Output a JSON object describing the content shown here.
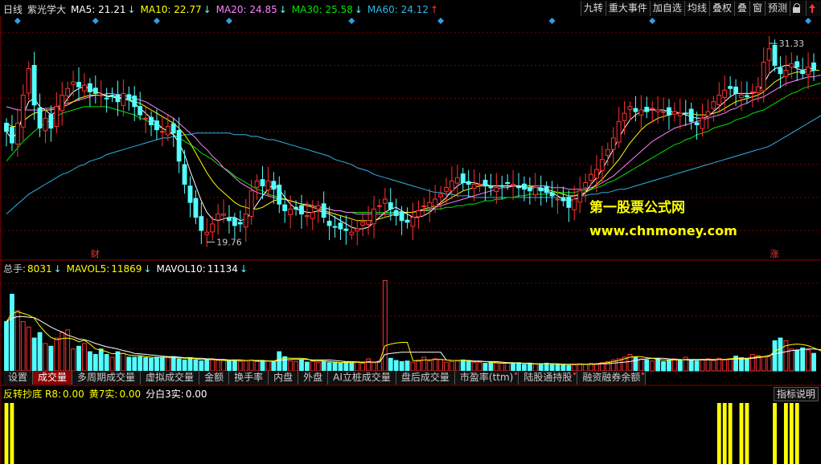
{
  "colors": {
    "up": "#ff3232",
    "down": "#54ffff",
    "ma5": "#ffffff",
    "ma10": "#ffff00",
    "ma20": "#ff80ff",
    "ma30": "#00e600",
    "ma60": "#2fb5e6",
    "grid": "#7a0000",
    "diamond": "#2fa0e0",
    "signal": "#ffff00"
  },
  "header": {
    "period": "日线",
    "name": "紫光学大",
    "ma5": {
      "label": "MA5:",
      "value": "21.21",
      "arrow": "↓"
    },
    "ma10": {
      "label": "MA10:",
      "value": "22.77",
      "arrow": "↓"
    },
    "ma20": {
      "label": "MA20:",
      "value": "24.85",
      "arrow": "↓"
    },
    "ma30": {
      "label": "MA30:",
      "value": "25.58",
      "arrow": "↓"
    },
    "ma60": {
      "label": "MA60:",
      "value": "24.12",
      "arrow": "↑"
    }
  },
  "toolbar": [
    "九转",
    "重大事件",
    "加自选",
    "均线",
    "叠权",
    "叠",
    "窗",
    "预测",
    "lock-icon",
    "up-arrow-icon"
  ],
  "price": {
    "high_label": "31.33",
    "low_label": "19.76",
    "ymin": 18.5,
    "ymax": 32.5,
    "markers": [
      {
        "text": "财",
        "i": 16
      },
      {
        "text": "涨",
        "i": 138
      }
    ],
    "diamonds": [
      2,
      16,
      27,
      40,
      62,
      78,
      98,
      116,
      144
    ]
  },
  "watermark": {
    "line1": "第一股票公式网",
    "line2": "www.chnmoney.com"
  },
  "volume": {
    "label": "总手:",
    "value": "8031",
    "arrow": "↓",
    "mavol5_label": "MAVOL5:",
    "mavol5": "11869",
    "mavol5_arrow": "↓",
    "mavol10_label": "MAVOL10:",
    "mavol10": "11134",
    "mavol10_arrow": "↓"
  },
  "tabs": [
    "设置",
    "成交量",
    "多周期成交量",
    "虚拟成交量",
    "金额",
    "换手率",
    "内盘",
    "外盘",
    "AI立桩成交量",
    "盘后成交量",
    "市盈率(ttm)",
    "陆股通持股",
    "融资融券余额"
  ],
  "active_tab": 1,
  "indicator": {
    "name": "反转抄底",
    "r8_label": "R8:",
    "r8": "0.00",
    "huang_label": "黄7实:",
    "huang": "0.00",
    "fen_label": "分白3实:",
    "fen": "0.00",
    "button": "指标说明"
  },
  "chart_data": {
    "type": "candlestick",
    "close": [
      26,
      25.3,
      26.5,
      28.2,
      29.8,
      27.6,
      26.2,
      26.8,
      26.2,
      27.5,
      28.2,
      28.6,
      29,
      28.7,
      28.8,
      28.4,
      28.3,
      28.2,
      28,
      28.1,
      27.8,
      28.3,
      27.9,
      27.5,
      27,
      26.8,
      26.4,
      26.1,
      26,
      26.3,
      25.9,
      24.2,
      22.8,
      21.7,
      20.8,
      20,
      19.9,
      20.4,
      21,
      21,
      20.6,
      20.3,
      20.4,
      21,
      22.4,
      23,
      22.7,
      23,
      22.5,
      21.6,
      21.2,
      21.3,
      21.3,
      21,
      20.9,
      21.1,
      21.5,
      20.8,
      20.3,
      20.2,
      20.1,
      20,
      19.9,
      20.1,
      20.5,
      20.6,
      21.3,
      21.5,
      21.9,
      21.3,
      20.9,
      20.6,
      20.5,
      20.8,
      21.2,
      21.5,
      21.7,
      21.9,
      22.2,
      22.6,
      23,
      23.2,
      22.9,
      22.8,
      22.8,
      22.8,
      22.7,
      22.6,
      22.6,
      22.7,
      22.9,
      22.8,
      22.6,
      22.5,
      22.4,
      22.6,
      22.4,
      22.3,
      22.1,
      21.9,
      21.8,
      21.4,
      21.9,
      22.4,
      22.9,
      23.4,
      23.7,
      24.3,
      24.9,
      25.6,
      26.6,
      27.1,
      27.5,
      27.2,
      27.3,
      27.2,
      27.4,
      27.3,
      27.2,
      27,
      27.2,
      27.1,
      27.1,
      26.6,
      26.4,
      26.8,
      27.2,
      27.8,
      28.2,
      28.5,
      28.6,
      28.3,
      28.2,
      28.1,
      28.4,
      28.7,
      30.2,
      31,
      30,
      29.5,
      29.7,
      30.1,
      29.9,
      29.5,
      29.9,
      29.7
    ],
    "ma5": [
      26,
      25.5,
      26,
      27,
      27.8,
      28,
      27.5,
      27.3,
      27,
      27.2,
      27.5,
      28,
      28.4,
      28.6,
      28.7,
      28.6,
      28.4,
      28.3,
      28.1,
      28.1,
      28,
      28,
      27.9,
      27.7,
      27.4,
      27.1,
      26.8,
      26.5,
      26.2,
      26,
      25.8,
      25.3,
      24.6,
      23.6,
      22.7,
      21.8,
      21.1,
      20.7,
      20.6,
      20.7,
      20.8,
      20.8,
      20.6,
      20.7,
      21.1,
      21.6,
      22.1,
      22.5,
      22.8,
      22.5,
      22,
      21.6,
      21.3,
      21.2,
      21.1,
      21.1,
      21.2,
      21.1,
      21,
      20.8,
      20.6,
      20.4,
      20.2,
      20.1,
      20.1,
      20.2,
      20.5,
      20.8,
      21.1,
      21.3,
      21.4,
      21.2,
      21,
      20.8,
      20.8,
      20.9,
      21.1,
      21.4,
      21.7,
      22,
      22.4,
      22.7,
      22.9,
      22.9,
      22.9,
      22.8,
      22.8,
      22.7,
      22.7,
      22.7,
      22.7,
      22.7,
      22.7,
      22.6,
      22.6,
      22.5,
      22.5,
      22.4,
      22.3,
      22.1,
      21.9,
      21.8,
      21.9,
      22,
      22.3,
      22.8,
      23.2,
      23.7,
      24.3,
      24.9,
      25.6,
      26.2,
      26.7,
      27,
      27.2,
      27.3,
      27.3,
      27.3,
      27.3,
      27.2,
      27.2,
      27.1,
      27,
      26.9,
      26.8,
      26.8,
      26.9,
      27.2,
      27.5,
      27.8,
      28.1,
      28.3,
      28.3,
      28.3,
      28.3,
      28.4,
      28.9,
      29.5,
      29.8,
      29.9,
      30,
      30,
      29.8,
      29.7,
      29.8,
      29.8
    ],
    "ma10": [
      26.5,
      26.3,
      26.3,
      26.6,
      26.9,
      27.1,
      27.2,
      27.3,
      27.3,
      27.4,
      27.5,
      27.6,
      27.8,
      28,
      28.1,
      28.2,
      28.2,
      28.2,
      28.2,
      28.1,
      28.1,
      28,
      27.9,
      27.8,
      27.7,
      27.5,
      27.3,
      27.1,
      26.9,
      26.7,
      26.5,
      26.2,
      25.8,
      25.3,
      24.7,
      24.1,
      23.5,
      23,
      22.6,
      22.3,
      22,
      21.7,
      21.5,
      21.4,
      21.3,
      21.3,
      21.4,
      21.6,
      21.8,
      21.9,
      21.9,
      21.8,
      21.7,
      21.6,
      21.5,
      21.4,
      21.3,
      21.2,
      21.1,
      21,
      20.9,
      20.8,
      20.7,
      20.6,
      20.6,
      20.6,
      20.6,
      20.7,
      20.8,
      20.9,
      21,
      21,
      21.1,
      21.1,
      21.2,
      21.3,
      21.4,
      21.5,
      21.6,
      21.8,
      22,
      22.2,
      22.4,
      22.5,
      22.6,
      22.7,
      22.7,
      22.7,
      22.7,
      22.7,
      22.7,
      22.7,
      22.7,
      22.7,
      22.7,
      22.6,
      22.6,
      22.5,
      22.4,
      22.3,
      22.2,
      22.1,
      22.1,
      22.2,
      22.3,
      22.5,
      22.8,
      23.1,
      23.5,
      23.9,
      24.3,
      24.8,
      25.3,
      25.7,
      26.1,
      26.4,
      26.6,
      26.8,
      26.9,
      27,
      27.1,
      27.1,
      27.1,
      27.1,
      27,
      27,
      27,
      27.1,
      27.2,
      27.4,
      27.6,
      27.8,
      27.9,
      28,
      28.1,
      28.2,
      28.4,
      28.7,
      29,
      29.2,
      29.4,
      29.5,
      29.6,
      29.6,
      29.6,
      29.7,
      29.7
    ],
    "ma20": [
      27.5,
      27.4,
      27.3,
      27.3,
      27.3,
      27.3,
      27.3,
      27.4,
      27.4,
      27.5,
      27.6,
      27.7,
      27.8,
      27.9,
      28,
      28.1,
      28.2,
      28.2,
      28.3,
      28.3,
      28.2,
      28.2,
      28.1,
      28,
      27.9,
      27.8,
      27.6,
      27.4,
      27.2,
      27,
      26.8,
      26.5,
      26.2,
      25.9,
      25.6,
      25.2,
      24.9,
      24.5,
      24.2,
      23.8,
      23.5,
      23.2,
      22.9,
      22.7,
      22.5,
      22.3,
      22.2,
      22.1,
      22,
      21.9,
      21.9,
      21.8,
      21.7,
      21.6,
      21.6,
      21.5,
      21.4,
      21.4,
      21.3,
      21.2,
      21.2,
      21.1,
      21.1,
      21,
      21,
      21,
      21,
      21,
      21,
      21,
      21.1,
      21.1,
      21.1,
      21.1,
      21.2,
      21.2,
      21.3,
      21.4,
      21.5,
      21.6,
      21.7,
      21.8,
      21.9,
      22,
      22.1,
      22.2,
      22.3,
      22.4,
      22.5,
      22.6,
      22.6,
      22.7,
      22.7,
      22.7,
      22.7,
      22.7,
      22.7,
      22.7,
      22.6,
      22.6,
      22.6,
      22.5,
      22.5,
      22.5,
      22.5,
      22.6,
      22.7,
      22.9,
      23.1,
      23.3,
      23.6,
      23.9,
      24.2,
      24.5,
      24.8,
      25.1,
      25.4,
      25.6,
      25.8,
      26,
      26.2,
      26.3,
      26.4,
      26.5,
      26.6,
      26.7,
      26.8,
      26.9,
      27,
      27.1,
      27.3,
      27.4,
      27.6,
      27.7,
      27.9,
      28,
      28.1,
      28.3,
      28.5,
      28.7,
      28.9,
      29,
      29.1,
      29.2,
      29.3,
      29.3,
      29.4,
      29.4
    ],
    "ma30": [
      24.2,
      24.6,
      25,
      25.4,
      25.7,
      26,
      26.3,
      26.5,
      26.7,
      26.9,
      27.1,
      27.2,
      27.3,
      27.4,
      27.5,
      27.5,
      27.5,
      27.5,
      27.5,
      27.4,
      27.3,
      27.2,
      27.1,
      27,
      26.8,
      26.7,
      26.5,
      26.3,
      26.2,
      26,
      25.8,
      25.6,
      25.4,
      25.2,
      25,
      24.7,
      24.5,
      24.3,
      24,
      23.8,
      23.6,
      23.3,
      23.1,
      22.9,
      22.7,
      22.5,
      22.4,
      22.2,
      22.1,
      22,
      21.9,
      21.8,
      21.7,
      21.6,
      21.5,
      21.5,
      21.4,
      21.3,
      21.3,
      21.2,
      21.2,
      21.1,
      21.1,
      21.1,
      21.1,
      21.1,
      21.1,
      21.1,
      21.1,
      21.1,
      21.1,
      21.1,
      21.1,
      21.1,
      21.2,
      21.2,
      21.2,
      21.3,
      21.3,
      21.4,
      21.4,
      21.5,
      21.5,
      21.6,
      21.6,
      21.7,
      21.8,
      21.8,
      21.9,
      21.9,
      22,
      22,
      22.1,
      22.1,
      22.2,
      22.2,
      22.2,
      22.2,
      22.3,
      22.3,
      22.3,
      22.3,
      22.3,
      22.4,
      22.4,
      22.5,
      22.6,
      22.7,
      22.9,
      23,
      23.2,
      23.4,
      23.6,
      23.8,
      24,
      24.2,
      24.4,
      24.6,
      24.8,
      25,
      25.2,
      25.3,
      25.5,
      25.6,
      25.8,
      25.9,
      26,
      26.2,
      26.3,
      26.4,
      26.5,
      26.7,
      26.8,
      26.9,
      27.1,
      27.2,
      27.3,
      27.5,
      27.7,
      27.9,
      28.1,
      28.3,
      28.4,
      28.6,
      28.7,
      28.8,
      28.9,
      29
    ],
    "ma60": [
      21,
      21.3,
      21.6,
      21.9,
      22.2,
      22.4,
      22.6,
      22.8,
      23,
      23.2,
      23.4,
      23.5,
      23.7,
      23.9,
      24,
      24.2,
      24.3,
      24.4,
      24.6,
      24.7,
      24.8,
      24.9,
      25,
      25.1,
      25.2,
      25.3,
      25.4,
      25.5,
      25.6,
      25.6,
      25.7,
      25.7,
      25.8,
      25.8,
      25.9,
      25.9,
      25.9,
      25.9,
      25.9,
      25.9,
      25.9,
      25.8,
      25.8,
      25.8,
      25.7,
      25.7,
      25.6,
      25.5,
      25.5,
      25.4,
      25.3,
      25.2,
      25.1,
      25,
      24.9,
      24.8,
      24.7,
      24.6,
      24.5,
      24.3,
      24.2,
      24.1,
      24,
      23.8,
      23.7,
      23.6,
      23.4,
      23.3,
      23.2,
      23.1,
      23,
      22.9,
      22.8,
      22.7,
      22.6,
      22.5,
      22.4,
      22.3,
      22.3,
      22.2,
      22.2,
      22.1,
      22.1,
      22.1,
      22,
      22,
      22,
      22,
      22,
      22,
      22,
      22,
      22,
      22,
      22,
      22,
      22,
      22,
      22,
      22,
      22,
      22,
      22.1,
      22.1,
      22.1,
      22.2,
      22.2,
      22.3,
      22.3,
      22.4,
      22.5,
      22.5,
      22.6,
      22.7,
      22.8,
      22.9,
      23,
      23.1,
      23.2,
      23.3,
      23.4,
      23.5,
      23.6,
      23.7,
      23.8,
      23.9,
      24,
      24.1,
      24.2,
      24.3,
      24.4,
      24.5,
      24.6,
      24.7,
      24.8,
      24.9,
      25,
      25.1,
      25.3,
      25.5,
      25.7,
      25.9,
      26.1,
      26.3,
      26.5,
      26.7,
      26.9,
      27.1
    ],
    "volume": [
      9000,
      14000,
      11000,
      9000,
      8000,
      6000,
      7000,
      5000,
      4500,
      6000,
      7000,
      7500,
      4000,
      4500,
      5000,
      3500,
      3000,
      4000,
      3000,
      2500,
      3500,
      3200,
      2500,
      2500,
      2600,
      2400,
      2300,
      2500,
      2500,
      2400,
      2600,
      2200,
      2000,
      2400,
      2000,
      1800,
      2200,
      2000,
      1900,
      2000,
      1800,
      2000,
      1700,
      1800,
      2000,
      1700,
      1900,
      1800,
      1700,
      3500,
      2600,
      1800,
      1700,
      2000,
      1600,
      1800,
      1500,
      1700,
      1500,
      1600,
      1400,
      1600,
      1400,
      1700,
      1400,
      2200,
      1500,
      1800,
      16500,
      2300,
      1900,
      1700,
      1800,
      1600,
      2000,
      2500,
      1800,
      2200,
      2100,
      1600,
      1700,
      1800,
      2000,
      1900,
      1500,
      1600,
      1400,
      1500,
      1400,
      1400,
      1400,
      1300,
      1500,
      1200,
      1400,
      1200,
      1300,
      1400,
      1200,
      1100,
      1200,
      1000,
      1100,
      1300,
      1200,
      1400,
      1300,
      1500,
      1700,
      2000,
      2200,
      2500,
      3000,
      2500,
      2200,
      2000,
      1800,
      2200,
      1700,
      2000,
      2200,
      1900,
      2500,
      2000,
      1800,
      2100,
      2200,
      1900,
      2300,
      2000,
      2200,
      2700,
      2400,
      2100,
      3000,
      2800,
      2500,
      2600,
      5500,
      6000,
      5500,
      4000,
      3800,
      4200,
      3800,
      3200,
      2800,
      2500
    ],
    "mavol5": [
      9000,
      10500,
      10800,
      10500,
      10200,
      9600,
      8200,
      7000,
      6100,
      5700,
      5900,
      6000,
      5800,
      5300,
      5600,
      4900,
      4000,
      3800,
      3500,
      3100,
      3200,
      3200,
      2900,
      2800,
      2800,
      2600,
      2500,
      2400,
      2500,
      2500,
      2400,
      2400,
      2300,
      2300,
      2200,
      2100,
      2100,
      2100,
      2000,
      1900,
      1900,
      1900,
      1900,
      1900,
      1900,
      1800,
      1800,
      1800,
      1800,
      2100,
      2400,
      2300,
      2300,
      2300,
      2200,
      1800,
      1800,
      1800,
      1700,
      1600,
      1500,
      1600,
      1500,
      1600,
      1500,
      1700,
      1600,
      1700,
      4600,
      4900,
      5100,
      5200,
      5200,
      1900,
      1800,
      2000,
      2000,
      2100,
      2100,
      2000,
      1900,
      1900,
      1900,
      1800,
      1700,
      1700,
      1700,
      1600,
      1500,
      1400,
      1400,
      1400,
      1400,
      1400,
      1300,
      1300,
      1300,
      1300,
      1300,
      1200,
      1200,
      1200,
      1200,
      1200,
      1200,
      1200,
      1300,
      1400,
      1500,
      1700,
      1900,
      2200,
      2500,
      2600,
      2600,
      2400,
      2300,
      2100,
      2000,
      2000,
      2000,
      2000,
      2100,
      2100,
      2100,
      2100,
      2100,
      2100,
      2100,
      2100,
      2200,
      2300,
      2300,
      2300,
      2400,
      2600,
      2600,
      2700,
      3600,
      4100,
      4600,
      4800,
      4900,
      4800,
      4600,
      4200,
      3800,
      3300
    ],
    "mavol10": [
      9000,
      9600,
      9900,
      9900,
      9800,
      9700,
      9200,
      8600,
      8000,
      7500,
      7100,
      6500,
      6200,
      5800,
      5700,
      5400,
      5000,
      4700,
      4400,
      4200,
      4000,
      3700,
      3500,
      3200,
      3100,
      3000,
      2900,
      2800,
      2700,
      2600,
      2600,
      2500,
      2400,
      2400,
      2300,
      2300,
      2200,
      2200,
      2100,
      2100,
      2000,
      2000,
      2000,
      1900,
      1900,
      1900,
      1900,
      1800,
      1800,
      1900,
      2000,
      2100,
      2100,
      2100,
      2100,
      2000,
      2000,
      2000,
      2000,
      1900,
      1800,
      1700,
      1700,
      1600,
      1600,
      1600,
      1600,
      1600,
      3000,
      3200,
      3300,
      3400,
      3400,
      3400,
      3400,
      3400,
      3400,
      3400,
      3400,
      2000,
      1900,
      1900,
      1900,
      1900,
      1800,
      1800,
      1700,
      1700,
      1700,
      1600,
      1500,
      1500,
      1400,
      1400,
      1400,
      1300,
      1300,
      1300,
      1300,
      1300,
      1200,
      1200,
      1200,
      1200,
      1200,
      1200,
      1200,
      1300,
      1300,
      1400,
      1500,
      1600,
      1700,
      1900,
      2100,
      2200,
      2300,
      2300,
      2300,
      2200,
      2100,
      2100,
      2000,
      2000,
      2000,
      2000,
      2000,
      2000,
      2100,
      2100,
      2100,
      2200,
      2200,
      2200,
      2300,
      2400,
      2600,
      2800,
      3100,
      3300,
      3500,
      3700,
      3800,
      3900,
      4000,
      4000,
      3900,
      3800
    ],
    "signal_bars": [
      0,
      1,
      128,
      129,
      130,
      132,
      133,
      138,
      140,
      141,
      142
    ]
  }
}
